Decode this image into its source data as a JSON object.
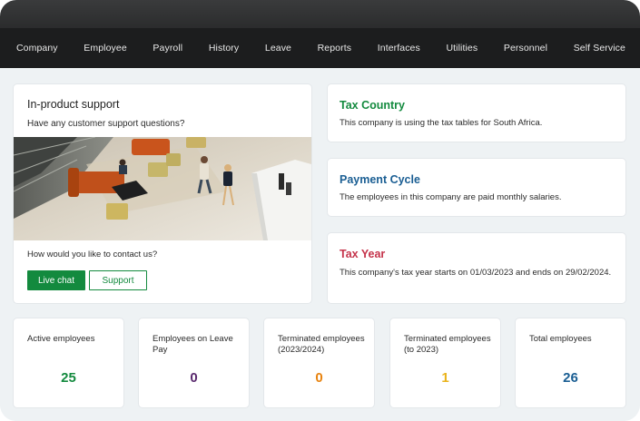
{
  "nav": {
    "items": [
      "Company",
      "Employee",
      "Payroll",
      "History",
      "Leave",
      "Reports",
      "Interfaces",
      "Utilities",
      "Personnel",
      "Self Service"
    ]
  },
  "support": {
    "title": "In-product support",
    "question": "Have any customer support questions?",
    "contact_label": "How would you like to contact us?",
    "live_chat_label": "Live chat",
    "support_label": "Support"
  },
  "tax_country": {
    "title": "Tax Country",
    "text": "This company is using the tax tables for South Africa.",
    "color": "#138a3e"
  },
  "payment_cycle": {
    "title": "Payment Cycle",
    "text": "The employees in this company are paid monthly salaries.",
    "color": "#1a5e93"
  },
  "tax_year": {
    "title": "Tax Year",
    "text": "This company's tax year starts on 01/03/2023 and ends on 29/02/2024.",
    "color": "#c5344b"
  },
  "stats": [
    {
      "label": "Active employees",
      "value": "25",
      "color": "#138a3e"
    },
    {
      "label": "Employees on Leave Pay",
      "value": "0",
      "color": "#5a2a6e"
    },
    {
      "label": "Terminated employees (2023/2024)",
      "value": "0",
      "color": "#e8830f"
    },
    {
      "label": "Terminated employees (to 2023)",
      "value": "1",
      "color": "#eab31b"
    },
    {
      "label": "Total employees",
      "value": "26",
      "color": "#1a5e93"
    }
  ],
  "colors": {
    "nav_bg": "#1c1d1e",
    "accent_green": "#138a3e",
    "page_bg": "#eef2f4"
  }
}
